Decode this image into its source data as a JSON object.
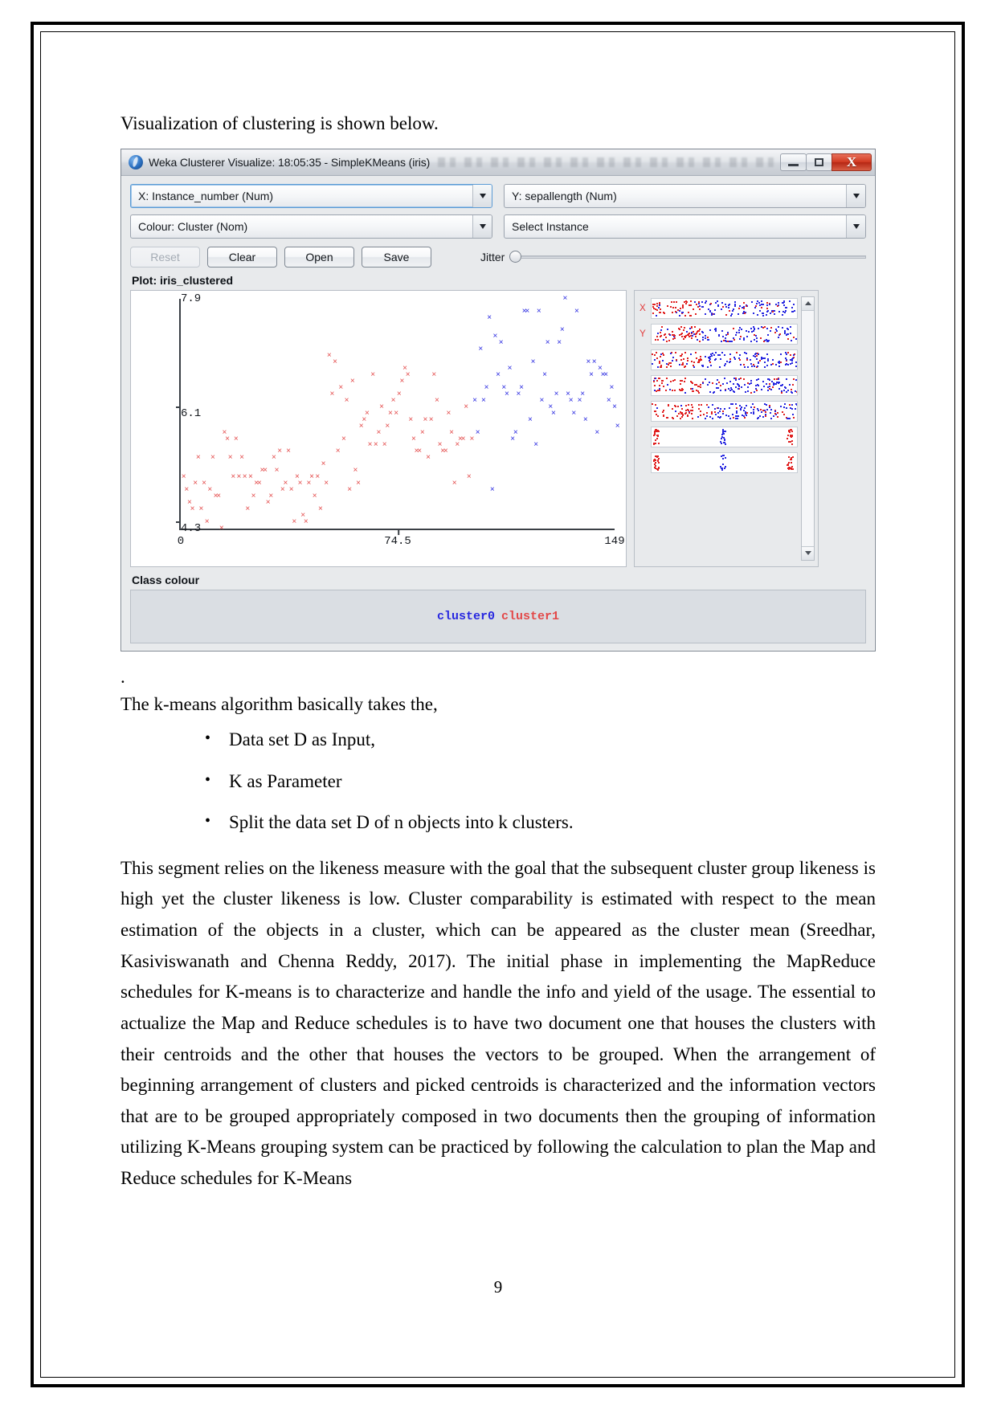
{
  "document": {
    "intro_line": "Visualization of clustering is shown below.",
    "stray_dot": ".",
    "lead_line": "The k-means algorithm basically takes the,",
    "bullets": [
      "Data set D as Input,",
      "K as Parameter",
      "Split the data set D of n objects into k clusters."
    ],
    "paragraph": "This segment relies on the likeness measure with the goal that the subsequent cluster group likeness is high yet the cluster likeness is low. Cluster comparability is estimated with respect to the mean estimation of the objects in a cluster, which can be appeared as the cluster mean (Sreedhar, Kasiviswanath and Chenna Reddy, 2017). The initial phase in implementing the MapReduce schedules for K-means is to characterize and handle the info and yield of the usage.  The essential to actualize the Map and Reduce schedules is to have two document one that houses the clusters with their centroids and the other that houses the vectors to be grouped. When the arrangement of beginning arrangement of clusters and picked centroids is characterized and the information vectors that are to be grouped appropriately composed in two documents then the grouping of information utilizing K-Means grouping system can be practiced by following the calculation to plan the Map and Reduce schedules for K-Means",
    "page_number": "9"
  },
  "weka_window": {
    "title": "Weka Clusterer Visualize: 18:05:35 - SimpleKMeans (iris)",
    "window_controls": {
      "minimize": "minimize-icon",
      "maximize": "maximize-icon",
      "close": "X"
    },
    "selectors": {
      "x_axis": "X: Instance_number (Num)",
      "y_axis": "Y: sepallength (Num)",
      "colour": "Colour: Cluster (Nom)",
      "instance": "Select Instance"
    },
    "buttons": {
      "reset": "Reset",
      "clear": "Clear",
      "open": "Open",
      "save": "Save"
    },
    "jitter_label": "Jitter",
    "jitter_value": 0,
    "plot_label": "Plot: iris_clustered",
    "class_colour_label": "Class colour",
    "legend": [
      {
        "label": "cluster0",
        "color": "#2727e0"
      },
      {
        "label": "cluster1",
        "color": "#e34848"
      }
    ],
    "attribute_panel": {
      "x_marker": "X",
      "y_marker": "Y",
      "strip_count": 7
    }
  },
  "chart_data": {
    "type": "scatter",
    "title": "Plot: iris_clustered",
    "xlabel": "Instance_number",
    "ylabel": "sepallength",
    "xlim": [
      0,
      149
    ],
    "ylim": [
      4.3,
      7.9
    ],
    "xticks": [
      "0",
      "74.5",
      "149"
    ],
    "yticks": [
      "7.9",
      "6.1",
      "4.3"
    ],
    "grid": false,
    "legend_position": "bottom",
    "series": [
      {
        "name": "cluster1",
        "color": "#e34848",
        "points": [
          [
            1,
            5.1
          ],
          [
            2,
            4.9
          ],
          [
            3,
            4.7
          ],
          [
            4,
            4.6
          ],
          [
            5,
            5.0
          ],
          [
            6,
            5.4
          ],
          [
            7,
            4.6
          ],
          [
            8,
            5.0
          ],
          [
            9,
            4.4
          ],
          [
            10,
            4.9
          ],
          [
            11,
            5.4
          ],
          [
            12,
            4.8
          ],
          [
            13,
            4.8
          ],
          [
            14,
            4.3
          ],
          [
            15,
            5.8
          ],
          [
            16,
            5.7
          ],
          [
            17,
            5.4
          ],
          [
            18,
            5.1
          ],
          [
            19,
            5.7
          ],
          [
            20,
            5.1
          ],
          [
            21,
            5.4
          ],
          [
            22,
            5.1
          ],
          [
            23,
            4.6
          ],
          [
            24,
            5.1
          ],
          [
            25,
            4.8
          ],
          [
            26,
            5.0
          ],
          [
            27,
            5.0
          ],
          [
            28,
            5.2
          ],
          [
            29,
            5.2
          ],
          [
            30,
            4.7
          ],
          [
            31,
            4.8
          ],
          [
            32,
            5.4
          ],
          [
            33,
            5.2
          ],
          [
            34,
            5.5
          ],
          [
            35,
            4.9
          ],
          [
            36,
            5.0
          ],
          [
            37,
            5.5
          ],
          [
            38,
            4.9
          ],
          [
            39,
            4.4
          ],
          [
            40,
            5.1
          ],
          [
            41,
            5.0
          ],
          [
            42,
            4.5
          ],
          [
            43,
            4.4
          ],
          [
            44,
            5.0
          ],
          [
            45,
            5.1
          ],
          [
            46,
            4.8
          ],
          [
            47,
            5.1
          ],
          [
            48,
            4.6
          ],
          [
            49,
            5.3
          ],
          [
            50,
            5.0
          ],
          [
            51,
            7.0
          ],
          [
            52,
            6.4
          ],
          [
            53,
            6.9
          ],
          [
            54,
            5.5
          ],
          [
            55,
            6.5
          ],
          [
            56,
            5.7
          ],
          [
            57,
            6.3
          ],
          [
            58,
            4.9
          ],
          [
            59,
            6.6
          ],
          [
            60,
            5.2
          ],
          [
            61,
            5.0
          ],
          [
            62,
            5.9
          ],
          [
            63,
            6.0
          ],
          [
            64,
            6.1
          ],
          [
            65,
            5.6
          ],
          [
            66,
            6.7
          ],
          [
            67,
            5.6
          ],
          [
            68,
            5.8
          ],
          [
            69,
            6.2
          ],
          [
            70,
            5.6
          ],
          [
            71,
            5.9
          ],
          [
            72,
            6.1
          ],
          [
            73,
            6.3
          ],
          [
            74,
            6.1
          ],
          [
            75,
            6.4
          ],
          [
            76,
            6.6
          ],
          [
            77,
            6.8
          ],
          [
            78,
            6.7
          ],
          [
            79,
            6.0
          ],
          [
            80,
            5.7
          ],
          [
            81,
            5.5
          ],
          [
            82,
            5.5
          ],
          [
            83,
            5.8
          ],
          [
            84,
            6.0
          ],
          [
            85,
            5.4
          ],
          [
            86,
            6.0
          ],
          [
            87,
            6.7
          ],
          [
            88,
            6.3
          ],
          [
            89,
            5.6
          ],
          [
            90,
            5.5
          ],
          [
            91,
            5.5
          ],
          [
            92,
            6.1
          ],
          [
            93,
            5.8
          ],
          [
            94,
            5.0
          ],
          [
            95,
            5.6
          ],
          [
            96,
            5.7
          ],
          [
            97,
            5.7
          ],
          [
            98,
            6.2
          ],
          [
            99,
            5.1
          ],
          [
            100,
            5.7
          ]
        ]
      },
      {
        "name": "cluster0",
        "color": "#2727e0",
        "points": [
          [
            101,
            6.3
          ],
          [
            102,
            5.8
          ],
          [
            103,
            7.1
          ],
          [
            104,
            6.3
          ],
          [
            105,
            6.5
          ],
          [
            106,
            7.6
          ],
          [
            107,
            4.9
          ],
          [
            108,
            7.3
          ],
          [
            109,
            6.7
          ],
          [
            110,
            7.2
          ],
          [
            111,
            6.5
          ],
          [
            112,
            6.4
          ],
          [
            113,
            6.8
          ],
          [
            114,
            5.7
          ],
          [
            115,
            5.8
          ],
          [
            116,
            6.4
          ],
          [
            117,
            6.5
          ],
          [
            118,
            7.7
          ],
          [
            119,
            7.7
          ],
          [
            120,
            6.0
          ],
          [
            121,
            6.9
          ],
          [
            122,
            5.6
          ],
          [
            123,
            7.7
          ],
          [
            124,
            6.3
          ],
          [
            125,
            6.7
          ],
          [
            126,
            7.2
          ],
          [
            127,
            6.2
          ],
          [
            128,
            6.1
          ],
          [
            129,
            6.4
          ],
          [
            130,
            7.2
          ],
          [
            131,
            7.4
          ],
          [
            132,
            7.9
          ],
          [
            133,
            6.4
          ],
          [
            134,
            6.3
          ],
          [
            135,
            6.1
          ],
          [
            136,
            7.7
          ],
          [
            137,
            6.3
          ],
          [
            138,
            6.4
          ],
          [
            139,
            6.0
          ],
          [
            140,
            6.9
          ],
          [
            141,
            6.7
          ],
          [
            142,
            6.9
          ],
          [
            143,
            5.8
          ],
          [
            144,
            6.8
          ],
          [
            145,
            6.7
          ],
          [
            146,
            6.7
          ],
          [
            147,
            6.3
          ],
          [
            148,
            6.5
          ],
          [
            149,
            6.2
          ],
          [
            150,
            5.9
          ]
        ]
      }
    ]
  }
}
